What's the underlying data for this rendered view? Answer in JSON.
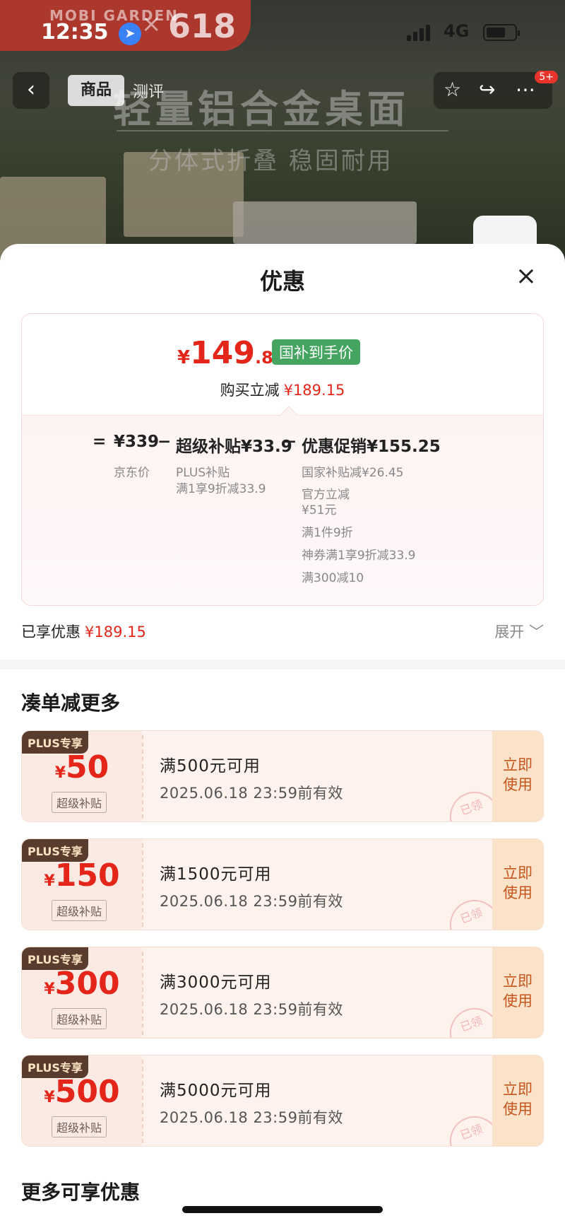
{
  "status_bar": {
    "time": "12:35",
    "network": "4G"
  },
  "banner": {
    "brand": "MOBI GARDEN",
    "separator": "×",
    "event": "618"
  },
  "nav": {
    "back_icon": "chevron-left",
    "tabs": [
      {
        "label": "商品"
      },
      {
        "label": "测评"
      }
    ],
    "badge": "5+"
  },
  "hero": {
    "title": "轻量铝合金桌面",
    "subtitle": "分体式折叠 稳固耐用"
  },
  "sheet": {
    "title": "优惠",
    "close_icon": "×"
  },
  "price": {
    "final_yen": "¥",
    "final_int": "149",
    "final_dec": ".85",
    "tag": "国补到手价",
    "buy_label": "购买立减",
    "buy_amount": "¥189.15"
  },
  "formula": {
    "eq": "=",
    "jd_price": "¥339",
    "jd_label": "京东价",
    "minus1": "−",
    "subsidy": "超级补贴¥33.9",
    "subsidy_detail1": "PLUS补贴",
    "subsidy_detail2": "满1享9折减33.9",
    "minus2": "−",
    "promo": "优惠促销¥155.25",
    "promo_details": [
      "国家补贴减¥26.45",
      "官方立减",
      "¥51元",
      "满1件9折",
      "神券满1享9折减33.9",
      "满300减10"
    ]
  },
  "enjoyed": {
    "label": "已享优惠",
    "amount": "¥189.15",
    "expand": "展开 ﹀"
  },
  "section_more": {
    "title": "凑单减更多"
  },
  "coupons": [
    {
      "tag": "PLUS专享",
      "yen": "¥",
      "amount": "50",
      "label": "超级补贴",
      "condition": "满500元可用",
      "date": "2025.06.18 23:59前有效",
      "action1": "立即",
      "action2": "使用",
      "stamp": "已领"
    },
    {
      "tag": "PLUS专享",
      "yen": "¥",
      "amount": "150",
      "label": "超级补贴",
      "condition": "满1500元可用",
      "date": "2025.06.18 23:59前有效",
      "action1": "立即",
      "action2": "使用",
      "stamp": "已领"
    },
    {
      "tag": "PLUS专享",
      "yen": "¥",
      "amount": "300",
      "label": "超级补贴",
      "condition": "满3000元可用",
      "date": "2025.06.18 23:59前有效",
      "action1": "立即",
      "action2": "使用",
      "stamp": "已领"
    },
    {
      "tag": "PLUS专享",
      "yen": "¥",
      "amount": "500",
      "label": "超级补贴",
      "condition": "满5000元可用",
      "date": "2025.06.18 23:59前有效",
      "action1": "立即",
      "action2": "使用",
      "stamp": "已领"
    }
  ],
  "section_other": {
    "title": "更多可享优惠"
  },
  "colors": {
    "accent_red": "#e4261a",
    "gov_green": "#45a560",
    "plus_brown": "#5a3c2e"
  }
}
